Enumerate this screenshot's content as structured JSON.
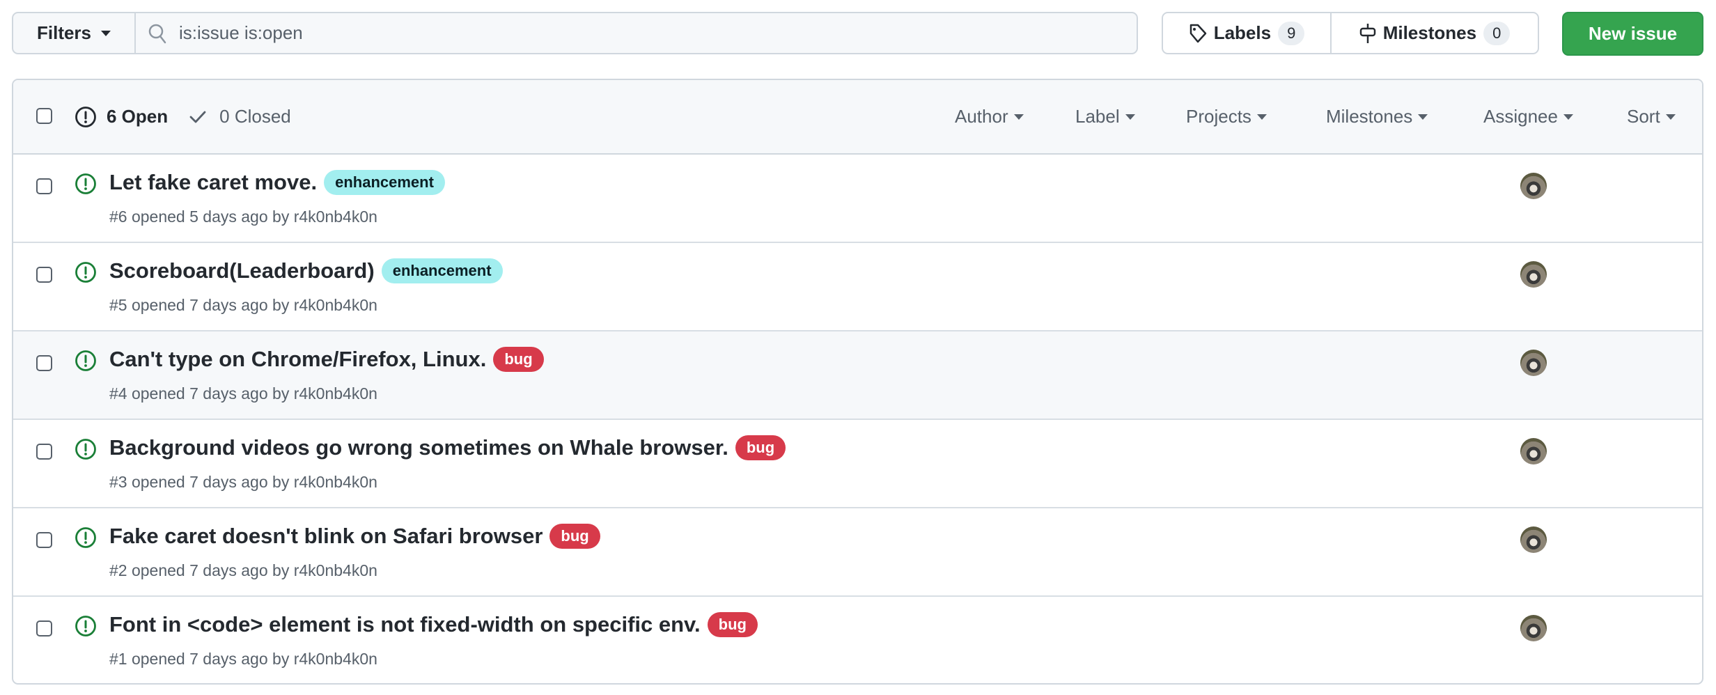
{
  "toolbar": {
    "filters_label": "Filters",
    "search_value": "is:issue is:open",
    "labels_label": "Labels",
    "labels_count": "9",
    "milestones_label": "Milestones",
    "milestones_count": "0",
    "new_issue_label": "New issue"
  },
  "header": {
    "open_label": "6 Open",
    "closed_label": "0 Closed",
    "filters": [
      "Author",
      "Label",
      "Projects",
      "Milestones",
      "Assignee",
      "Sort"
    ]
  },
  "issues": [
    {
      "title": "Let fake caret move.",
      "label": "enhancement",
      "meta": "#6 opened 5 days ago by r4k0nb4k0n"
    },
    {
      "title": "Scoreboard(Leaderboard)",
      "label": "enhancement",
      "meta": "#5 opened 7 days ago by r4k0nb4k0n"
    },
    {
      "title": "Can't type on Chrome/Firefox, Linux.",
      "label": "bug",
      "meta": "#4 opened 7 days ago by r4k0nb4k0n"
    },
    {
      "title": "Background videos go wrong sometimes on Whale browser.",
      "label": "bug",
      "meta": "#3 opened 7 days ago by r4k0nb4k0n"
    },
    {
      "title": "Fake caret doesn't blink on Safari browser",
      "label": "bug",
      "meta": "#2 opened 7 days ago by r4k0nb4k0n"
    },
    {
      "title": "Font in <code> element is not fixed-width on specific env.",
      "label": "bug",
      "meta": "#1 opened 7 days ago by r4k0nb4k0n"
    }
  ],
  "colors": {
    "accent_green": "#35a44f",
    "open_icon": "#1a7f37",
    "bug": "#d73a4a",
    "enhancement": "#a2eeef"
  }
}
